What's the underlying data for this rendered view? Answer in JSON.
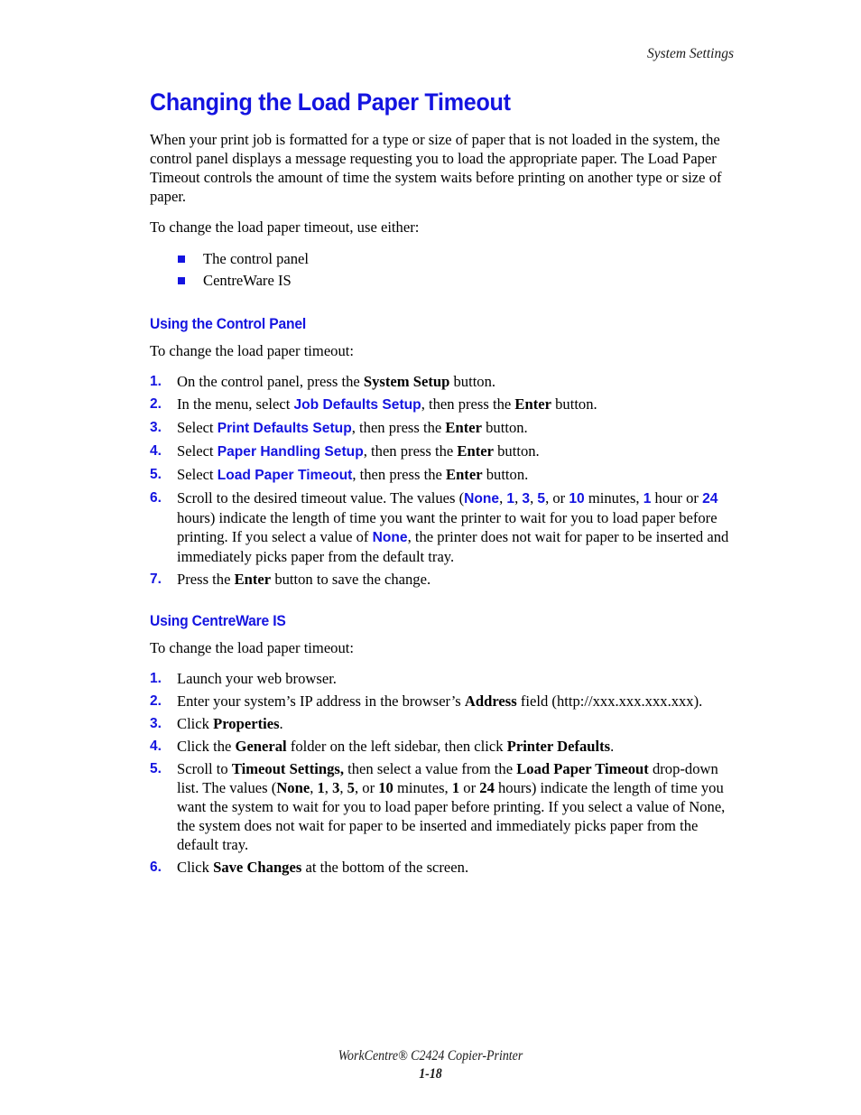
{
  "accent_color": "#1414e0",
  "header": {
    "running_head": "System Settings"
  },
  "page_title": "Changing the Load Paper Timeout",
  "intro": {
    "paragraph1": "When your print job is formatted for a type or size of paper that is not loaded in the system, the control panel displays a message requesting you to load the appropriate paper. The Load Paper Timeout controls the amount of time the system waits before printing on another type or size of paper.",
    "paragraph2": "To change the load paper timeout, use either:",
    "bullets": [
      "The control panel",
      "CentreWare IS"
    ]
  },
  "section_control_panel": {
    "heading": "Using the Control Panel",
    "lead": "To change the load paper timeout:",
    "steps": [
      {
        "number": "1.",
        "parts": [
          {
            "t": "On the control panel, press the ",
            "s": "plain"
          },
          {
            "t": "System Setup",
            "s": "bold"
          },
          {
            "t": " button.",
            "s": "plain"
          }
        ]
      },
      {
        "number": "2.",
        "parts": [
          {
            "t": "In the menu, select ",
            "s": "plain"
          },
          {
            "t": "Job Defaults Setup",
            "s": "ui"
          },
          {
            "t": ", then press the ",
            "s": "plain"
          },
          {
            "t": "Enter",
            "s": "bold"
          },
          {
            "t": " button.",
            "s": "plain"
          }
        ]
      },
      {
        "number": "3.",
        "parts": [
          {
            "t": "Select ",
            "s": "plain"
          },
          {
            "t": "Print Defaults Setup",
            "s": "ui"
          },
          {
            "t": ", then press the ",
            "s": "plain"
          },
          {
            "t": "Enter",
            "s": "bold"
          },
          {
            "t": " button.",
            "s": "plain"
          }
        ]
      },
      {
        "number": "4.",
        "parts": [
          {
            "t": "Select ",
            "s": "plain"
          },
          {
            "t": "Paper Handling Setup",
            "s": "ui"
          },
          {
            "t": ", then press the ",
            "s": "plain"
          },
          {
            "t": "Enter",
            "s": "bold"
          },
          {
            "t": " button.",
            "s": "plain"
          }
        ]
      },
      {
        "number": "5.",
        "parts": [
          {
            "t": "Select ",
            "s": "plain"
          },
          {
            "t": "Load Paper Timeout",
            "s": "ui"
          },
          {
            "t": ", then press the ",
            "s": "plain"
          },
          {
            "t": "Enter",
            "s": "bold"
          },
          {
            "t": " button.",
            "s": "plain"
          }
        ]
      },
      {
        "number": "6.",
        "parts": [
          {
            "t": "Scroll to the desired timeout value. The values (",
            "s": "plain"
          },
          {
            "t": "None",
            "s": "ui"
          },
          {
            "t": ", ",
            "s": "plain"
          },
          {
            "t": "1",
            "s": "ui"
          },
          {
            "t": ", ",
            "s": "plain"
          },
          {
            "t": "3",
            "s": "ui"
          },
          {
            "t": ", ",
            "s": "plain"
          },
          {
            "t": "5",
            "s": "ui"
          },
          {
            "t": ", or ",
            "s": "plain"
          },
          {
            "t": "10",
            "s": "ui"
          },
          {
            "t": " minutes, ",
            "s": "plain"
          },
          {
            "t": "1",
            "s": "ui"
          },
          {
            "t": " hour or ",
            "s": "plain"
          },
          {
            "t": "24",
            "s": "ui"
          },
          {
            "t": " hours) indicate the length of time you want the printer to wait for you to load paper before printing. If you select a value of ",
            "s": "plain"
          },
          {
            "t": "None",
            "s": "ui"
          },
          {
            "t": ", the printer does not wait for paper to be inserted and immediately picks paper from the default tray.",
            "s": "plain"
          }
        ]
      },
      {
        "number": "7.",
        "parts": [
          {
            "t": "Press the ",
            "s": "plain"
          },
          {
            "t": "Enter",
            "s": "bold"
          },
          {
            "t": " button to save the change.",
            "s": "plain"
          }
        ]
      }
    ]
  },
  "section_centreware": {
    "heading": "Using CentreWare IS",
    "lead": "To change the load paper timeout:",
    "steps": [
      {
        "number": "1.",
        "parts": [
          {
            "t": "Launch your web browser.",
            "s": "plain"
          }
        ]
      },
      {
        "number": "2.",
        "parts": [
          {
            "t": "Enter your system’s IP address in the browser’s ",
            "s": "plain"
          },
          {
            "t": "Address",
            "s": "bold"
          },
          {
            "t": " field (http://xxx.xxx.xxx.xxx).",
            "s": "plain"
          }
        ]
      },
      {
        "number": "3.",
        "parts": [
          {
            "t": "Click ",
            "s": "plain"
          },
          {
            "t": "Properties",
            "s": "bold"
          },
          {
            "t": ".",
            "s": "plain"
          }
        ]
      },
      {
        "number": "4.",
        "parts": [
          {
            "t": "Click the ",
            "s": "plain"
          },
          {
            "t": "General",
            "s": "bold"
          },
          {
            "t": " folder on the left sidebar, then click ",
            "s": "plain"
          },
          {
            "t": "Printer Defaults",
            "s": "bold"
          },
          {
            "t": ".",
            "s": "plain"
          }
        ]
      },
      {
        "number": "5.",
        "parts": [
          {
            "t": "Scroll to ",
            "s": "plain"
          },
          {
            "t": "Timeout Settings,",
            "s": "bold"
          },
          {
            "t": " then select a value from the ",
            "s": "plain"
          },
          {
            "t": "Load Paper Timeout",
            "s": "bold"
          },
          {
            "t": " drop-down list. The values (",
            "s": "plain"
          },
          {
            "t": "None",
            "s": "bold"
          },
          {
            "t": ", ",
            "s": "plain"
          },
          {
            "t": "1",
            "s": "bold"
          },
          {
            "t": ", ",
            "s": "plain"
          },
          {
            "t": "3",
            "s": "bold"
          },
          {
            "t": ", ",
            "s": "plain"
          },
          {
            "t": "5",
            "s": "bold"
          },
          {
            "t": ", or ",
            "s": "plain"
          },
          {
            "t": "10",
            "s": "bold"
          },
          {
            "t": " minutes, ",
            "s": "plain"
          },
          {
            "t": "1",
            "s": "bold"
          },
          {
            "t": " or ",
            "s": "plain"
          },
          {
            "t": "24",
            "s": "bold"
          },
          {
            "t": " hours) indicate the length of time you want the system to wait for you to load paper before printing. If you select a value of None, the system does not wait for paper to be inserted and immediately picks paper from the default tray.",
            "s": "plain"
          }
        ]
      },
      {
        "number": "6.",
        "parts": [
          {
            "t": "Click ",
            "s": "plain"
          },
          {
            "t": "Save Changes",
            "s": "bold"
          },
          {
            "t": " at the bottom of the screen.",
            "s": "plain"
          }
        ]
      }
    ]
  },
  "footer": {
    "product_line": "WorkCentre® C2424 Copier-Printer",
    "page_number": "1-18"
  }
}
